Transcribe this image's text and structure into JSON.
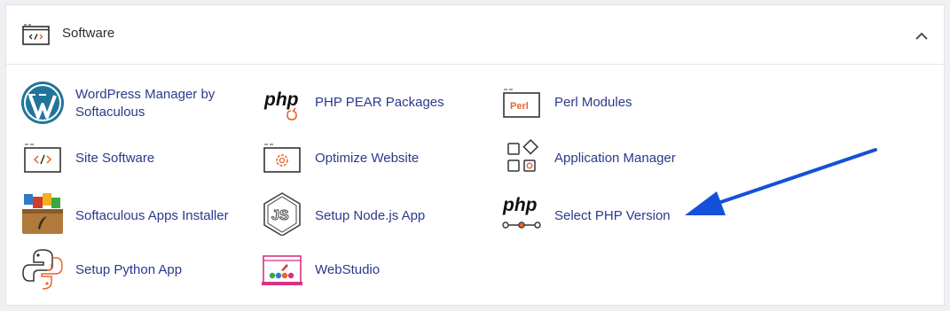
{
  "section": {
    "title": "Software",
    "icon": "code-window-icon",
    "collapse_icon": "chevron-up-icon"
  },
  "colors": {
    "link": "#293a8c",
    "accent_orange": "#e8652b",
    "arrow_blue": "#1451d9"
  },
  "items": [
    {
      "label": "WordPress Manager by Softaculous",
      "icon": "wordpress-icon"
    },
    {
      "label": "PHP PEAR Packages",
      "icon": "php-pear-icon"
    },
    {
      "label": "Perl Modules",
      "icon": "perl-icon"
    },
    {
      "label": "Site Software",
      "icon": "code-window-icon"
    },
    {
      "label": "Optimize Website",
      "icon": "gear-window-icon"
    },
    {
      "label": "Application Manager",
      "icon": "app-grid-icon"
    },
    {
      "label": "Softaculous Apps Installer",
      "icon": "softaculous-icon"
    },
    {
      "label": "Setup Node.js App",
      "icon": "nodejs-icon"
    },
    {
      "label": "Select PHP Version",
      "icon": "php-version-icon"
    },
    {
      "label": "Setup Python App",
      "icon": "python-icon"
    },
    {
      "label": "WebStudio",
      "icon": "webstudio-icon"
    }
  ],
  "perl_icon_text": "Perl",
  "php_icon_text": "php",
  "nodejs_icon_text": "JS"
}
